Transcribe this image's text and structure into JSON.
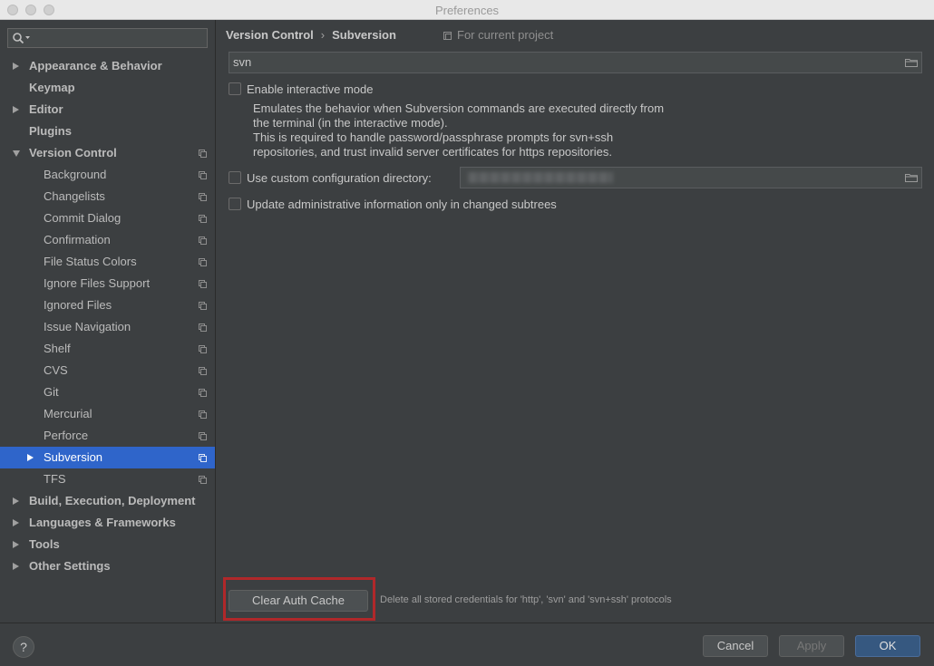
{
  "window": {
    "title": "Preferences"
  },
  "sidebar": {
    "search": {
      "value": ""
    },
    "items": [
      {
        "label": "Appearance & Behavior",
        "bold": true,
        "arrow": "right",
        "indent": 0,
        "project": false
      },
      {
        "label": "Keymap",
        "bold": true,
        "arrow": "",
        "indent": 0,
        "project": false
      },
      {
        "label": "Editor",
        "bold": true,
        "arrow": "right",
        "indent": 0,
        "project": false
      },
      {
        "label": "Plugins",
        "bold": true,
        "arrow": "",
        "indent": 0,
        "project": false
      },
      {
        "label": "Version Control",
        "bold": true,
        "arrow": "down",
        "indent": 0,
        "project": true
      },
      {
        "label": "Background",
        "bold": false,
        "arrow": "",
        "indent": 1,
        "project": true
      },
      {
        "label": "Changelists",
        "bold": false,
        "arrow": "",
        "indent": 1,
        "project": true
      },
      {
        "label": "Commit Dialog",
        "bold": false,
        "arrow": "",
        "indent": 1,
        "project": true
      },
      {
        "label": "Confirmation",
        "bold": false,
        "arrow": "",
        "indent": 1,
        "project": true
      },
      {
        "label": "File Status Colors",
        "bold": false,
        "arrow": "",
        "indent": 1,
        "project": true
      },
      {
        "label": "Ignore Files Support",
        "bold": false,
        "arrow": "",
        "indent": 1,
        "project": true
      },
      {
        "label": "Ignored Files",
        "bold": false,
        "arrow": "",
        "indent": 1,
        "project": true
      },
      {
        "label": "Issue Navigation",
        "bold": false,
        "arrow": "",
        "indent": 1,
        "project": true
      },
      {
        "label": "Shelf",
        "bold": false,
        "arrow": "",
        "indent": 1,
        "project": true
      },
      {
        "label": "CVS",
        "bold": false,
        "arrow": "",
        "indent": 1,
        "project": true
      },
      {
        "label": "Git",
        "bold": false,
        "arrow": "",
        "indent": 1,
        "project": true
      },
      {
        "label": "Mercurial",
        "bold": false,
        "arrow": "",
        "indent": 1,
        "project": true
      },
      {
        "label": "Perforce",
        "bold": false,
        "arrow": "",
        "indent": 1,
        "project": true
      },
      {
        "label": "Subversion",
        "bold": false,
        "arrow": "right",
        "indent": 1,
        "project": true,
        "selected": true
      },
      {
        "label": "TFS",
        "bold": false,
        "arrow": "",
        "indent": 1,
        "project": true
      },
      {
        "label": "Build, Execution, Deployment",
        "bold": true,
        "arrow": "right",
        "indent": 0,
        "project": false
      },
      {
        "label": "Languages & Frameworks",
        "bold": true,
        "arrow": "right",
        "indent": 0,
        "project": false
      },
      {
        "label": "Tools",
        "bold": true,
        "arrow": "right",
        "indent": 0,
        "project": false
      },
      {
        "label": "Other Settings",
        "bold": true,
        "arrow": "right",
        "indent": 0,
        "project": false
      }
    ]
  },
  "breadcrumb": {
    "parent": "Version Control",
    "separator": "›",
    "current": "Subversion"
  },
  "scope": {
    "label": "For current project"
  },
  "svn_path": {
    "value": "svn"
  },
  "options": {
    "interactive": {
      "label": "Enable interactive mode",
      "checked": false
    },
    "description": [
      "Emulates the behavior when Subversion commands are executed directly from",
      "the terminal (in the interactive mode).",
      "This is required to handle password/passphrase prompts for svn+ssh",
      "repositories, and trust invalid server certificates for https repositories."
    ],
    "custom_config": {
      "label": "Use custom configuration directory:",
      "checked": false
    },
    "update_admin": {
      "label": "Update administrative information only in changed subtrees",
      "checked": false
    }
  },
  "auth": {
    "button": "Clear Auth Cache",
    "description": "Delete all stored credentials for 'http', 'svn' and 'svn+ssh' protocols"
  },
  "footer": {
    "help": "?",
    "cancel": "Cancel",
    "apply": "Apply",
    "ok": "OK"
  },
  "colors": {
    "selection": "#2f65ca",
    "highlight_border": "#b0282a",
    "ok_button": "#365880"
  }
}
